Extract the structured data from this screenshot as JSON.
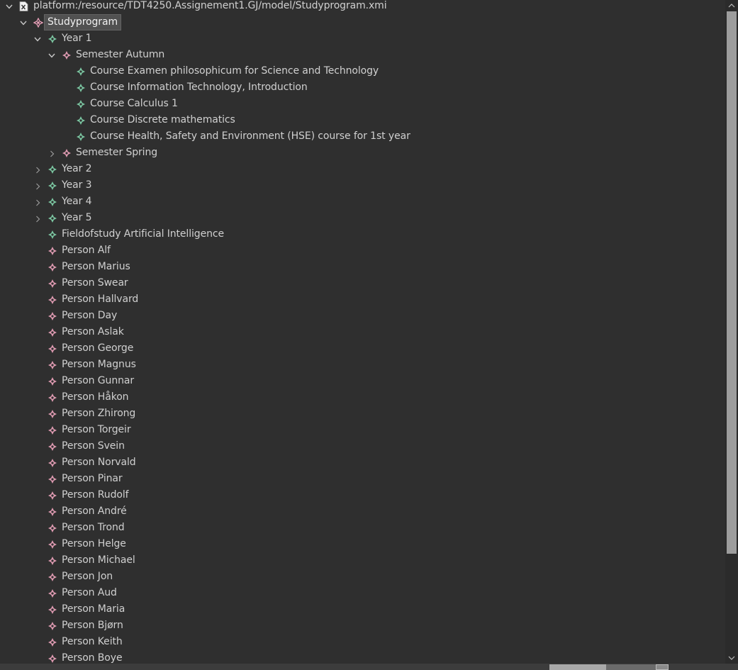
{
  "colors": {
    "background": "#2f2f2f",
    "text": "#d0d0d0",
    "selection": "#515151",
    "class_icon_green": "#7fcfa8",
    "class_icon_pink": "#e8a0b8",
    "scrollbar_thumb": "#9d9d9d"
  },
  "root": {
    "label": "platform:/resource/TDT4250.Assignement1.GJ/model/Studyprogram.xmi",
    "icon": "xmi-file-icon",
    "expanded": true
  },
  "studyprogram": {
    "label": "Studyprogram",
    "icon": "studyprogram-icon",
    "selected": true,
    "expanded": true
  },
  "year1": {
    "label": "Year 1",
    "expanded": true,
    "semester_autumn": {
      "label": "Semester Autumn",
      "expanded": true,
      "courses": [
        "Course Examen philosophicum for Science and Technology",
        "Course Information Technology, Introduction",
        "Course Calculus 1",
        "Course Discrete mathematics",
        "Course Health, Safety and Environment (HSE) course for 1st year"
      ]
    },
    "semester_spring": {
      "label": "Semester Spring",
      "expanded": false
    }
  },
  "collapsed_years": [
    "Year 2",
    "Year 3",
    "Year 4",
    "Year 5"
  ],
  "fieldofstudy": "Fieldofstudy Artificial Intelligence",
  "persons": [
    "Person Alf",
    "Person Marius",
    "Person Swear",
    "Person Hallvard",
    "Person Day",
    "Person Aslak",
    "Person George",
    "Person Magnus",
    "Person Gunnar",
    "Person Håkon",
    "Person Zhirong",
    "Person Torgeir",
    "Person Svein",
    "Person Norvald",
    "Person Pinar",
    "Person Rudolf",
    "Person André",
    "Person Trond",
    "Person Helge",
    "Person Michael",
    "Person Jon",
    "Person Aud",
    "Person Maria",
    "Person Bjørn",
    "Person Keith",
    "Person Boye"
  ]
}
